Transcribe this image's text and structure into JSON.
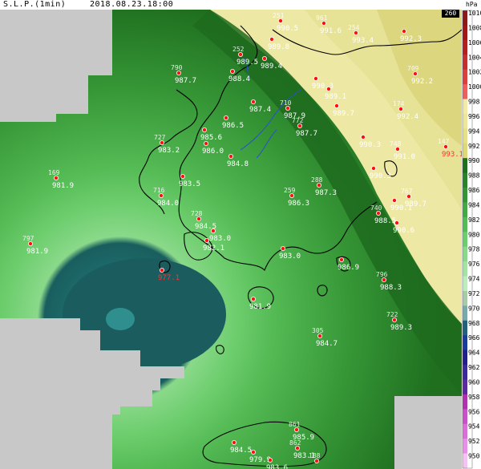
{
  "header": {
    "title": "S.L.P.(1min)",
    "timestamp": "2018.08.23.18:00"
  },
  "badge": "260",
  "legend": {
    "unit": "hPa",
    "levels": [
      1010,
      1008,
      1006,
      1004,
      1002,
      1000,
      998,
      996,
      994,
      992,
      990,
      988,
      986,
      984,
      982,
      980,
      978,
      976,
      974,
      972,
      970,
      968,
      966,
      964,
      962,
      960,
      958,
      956,
      954,
      952,
      950
    ],
    "colors": [
      "#8a1a1a",
      "#a01515",
      "#b02020",
      "#c03030",
      "#d84040",
      "#e86060",
      "#f3e9a8",
      "#eae79a",
      "#e3df8a",
      "#ddd87a",
      "#1f6f1f",
      "#2a822a",
      "#359535",
      "#44a844",
      "#55bb55",
      "#6ccd6c",
      "#8ad98a",
      "#a4e3a4",
      "#bfecbf",
      "#a9c9a9",
      "#7aa9a9",
      "#23607a",
      "#1b3a9a",
      "#20208a",
      "#3a2a9a",
      "#5a2aa0",
      "#b030b0",
      "#c850c8",
      "#d870d8",
      "#e690e6",
      "#f3c3f3"
    ]
  },
  "stations": [
    {
      "id": "251",
      "value": "990.5"
    },
    {
      "id": "961",
      "value": "991.6"
    },
    {
      "id": "254",
      "value": "993.4"
    },
    {
      "id": "",
      "value": "992.3"
    },
    {
      "id": "",
      "value": "989.8"
    },
    {
      "id": "252",
      "value": "989.5"
    },
    {
      "id": "",
      "value": "989.4"
    },
    {
      "id": "790",
      "value": "987.7"
    },
    {
      "id": "",
      "value": "988.4"
    },
    {
      "id": "",
      "value": "990.3"
    },
    {
      "id": "",
      "value": "989.1"
    },
    {
      "id": "709",
      "value": "992.2"
    },
    {
      "id": "",
      "value": "987.4"
    },
    {
      "id": "710",
      "value": "987.9"
    },
    {
      "id": "",
      "value": "989.7"
    },
    {
      "id": "174",
      "value": "992.4"
    },
    {
      "id": "",
      "value": "986.5"
    },
    {
      "id": "772",
      "value": "987.7"
    },
    {
      "id": "",
      "value": "985.6"
    },
    {
      "id": "",
      "value": "990.3"
    },
    {
      "id": "748",
      "value": "991.0"
    },
    {
      "id": "147",
      "value": "993.1"
    },
    {
      "id": "727",
      "value": "983.2"
    },
    {
      "id": "",
      "value": "986.0"
    },
    {
      "id": "",
      "value": "984.8"
    },
    {
      "id": "",
      "value": "990.3"
    },
    {
      "id": "169",
      "value": "981.9"
    },
    {
      "id": "",
      "value": "983.5"
    },
    {
      "id": "288",
      "value": "987.3"
    },
    {
      "id": "716",
      "value": "984.0"
    },
    {
      "id": "259",
      "value": "986.3"
    },
    {
      "id": "767",
      "value": "989.7"
    },
    {
      "id": "",
      "value": "990.1"
    },
    {
      "id": "740",
      "value": "988.5"
    },
    {
      "id": "",
      "value": "990.6"
    },
    {
      "id": "728",
      "value": "984.5"
    },
    {
      "id": "",
      "value": "983.0"
    },
    {
      "id": "",
      "value": "982.1"
    },
    {
      "id": "797",
      "value": "981.9"
    },
    {
      "id": "",
      "value": "983.0"
    },
    {
      "id": "",
      "value": "986.9"
    },
    {
      "id": "",
      "value": "977.1"
    },
    {
      "id": "796",
      "value": "988.3"
    },
    {
      "id": "",
      "value": "981.9"
    },
    {
      "id": "722",
      "value": "989.3"
    },
    {
      "id": "305",
      "value": "984.7"
    },
    {
      "id": "861",
      "value": "985.9"
    },
    {
      "id": "",
      "value": "984.5"
    },
    {
      "id": "",
      "value": "979.9"
    },
    {
      "id": "",
      "value": "983.6"
    },
    {
      "id": "862",
      "value": "983.1"
    },
    {
      "id": "188",
      "value": ""
    }
  ]
}
